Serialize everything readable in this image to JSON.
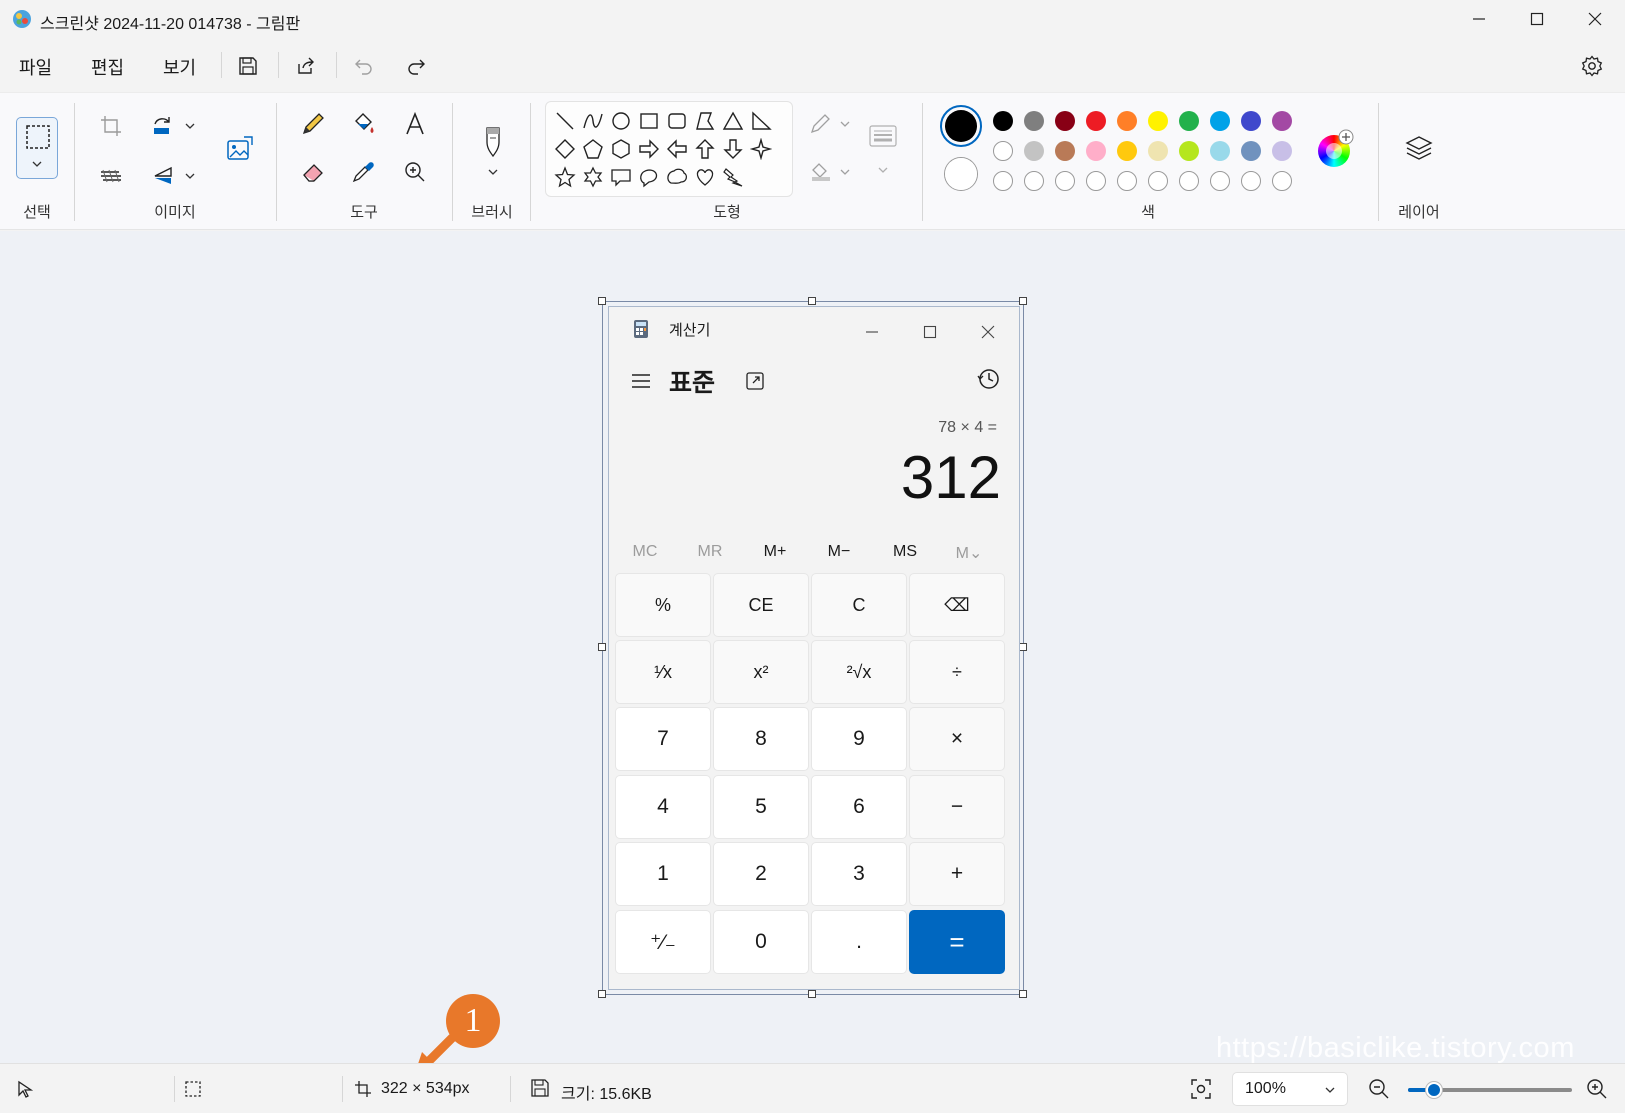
{
  "window": {
    "title": "스크린샷 2024-11-20 014738 - 그림판"
  },
  "menu": {
    "file": "파일",
    "edit": "편집",
    "view": "보기"
  },
  "ribbon": {
    "groups": {
      "select": "선택",
      "image": "이미지",
      "tools": "도구",
      "brush": "브러시",
      "shapes": "도형",
      "colors": "색",
      "layers": "레이어"
    },
    "palette_row1": [
      "#000000",
      "#7f7f7f",
      "#880015",
      "#ed1c24",
      "#ff7f27",
      "#fff200",
      "#22b14c",
      "#00a2e8",
      "#3f48cc",
      "#a349a4"
    ],
    "palette_row2": [
      "#ffffff",
      "#c3c3c3",
      "#b97a57",
      "#ffaec9",
      "#ffc90e",
      "#efe4b0",
      "#b5e61d",
      "#99d9ea",
      "#7092be",
      "#c8bfe7"
    ],
    "color1": "#000000",
    "color2": "#ffffff"
  },
  "calculator": {
    "title": "계산기",
    "mode": "표준",
    "expression": "78 × 4 =",
    "result": "312",
    "memory": [
      "MC",
      "MR",
      "M+",
      "M−",
      "MS",
      "M⌄"
    ],
    "keys": [
      [
        "%",
        "CE",
        "C",
        "⌫"
      ],
      [
        "¹⁄x",
        "x²",
        "²√x",
        "÷"
      ],
      [
        "7",
        "8",
        "9",
        "×"
      ],
      [
        "4",
        "5",
        "6",
        "−"
      ],
      [
        "1",
        "2",
        "3",
        "+"
      ],
      [
        "⁺⁄₋",
        "0",
        ".",
        "="
      ]
    ]
  },
  "annotation": {
    "badge": "1",
    "watermark": "https://basiclike.tistory.com"
  },
  "status": {
    "dimensions": "322 × 534px",
    "size": "크기: 15.6KB",
    "zoom": "100%",
    "zoom_level_percent": 100
  }
}
